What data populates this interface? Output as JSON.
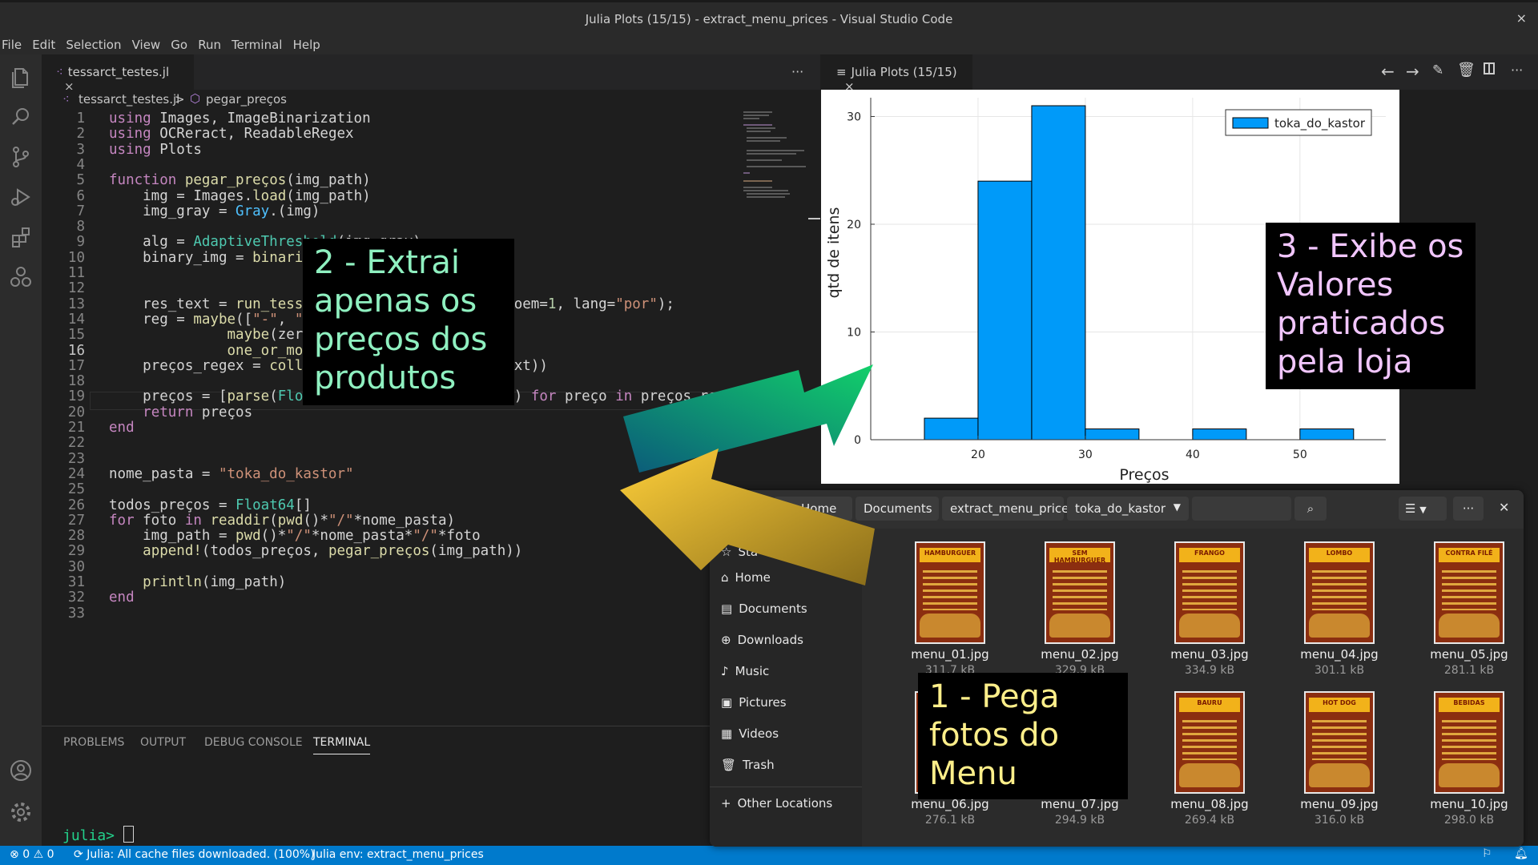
{
  "window": {
    "title": "Julia Plots (15/15) - extract_menu_prices - Visual Studio Code",
    "close": "×"
  },
  "menu": [
    "File",
    "Edit",
    "Selection",
    "View",
    "Go",
    "Run",
    "Terminal",
    "Help"
  ],
  "editor": {
    "tab_label": "tessarct_testes.jl",
    "tab_close": "×",
    "more": "···",
    "breadcrumb": {
      "file": "tessarct_testes.jl",
      "sep": ">",
      "symbol": "pegar_preços"
    },
    "current_line": 16
  },
  "panel": {
    "tabs": [
      "PROBLEMS",
      "OUTPUT",
      "DEBUG CONSOLE",
      "TERMINAL"
    ],
    "active": "TERMINAL",
    "prompt": "julia>"
  },
  "status": {
    "errors": "0",
    "warnings": "0",
    "julia_msg": "Julia: All cache files downloaded. (100%)",
    "env": "Julia env: extract_menu_prices"
  },
  "plot_pane": {
    "tab_label": "Julia Plots (15/15)",
    "tab_close": "×"
  },
  "chart_data": {
    "type": "bar",
    "xlabel": "Preços",
    "ylabel": "qtd de itens",
    "legend": "toka_do_kastor",
    "legend_position": "top-right",
    "color": "#009af9",
    "xlim": [
      10,
      58
    ],
    "ylim": [
      0,
      31
    ],
    "xticks": [
      20,
      30,
      40,
      50
    ],
    "yticks": [
      0,
      10,
      20,
      30
    ],
    "bins": [
      {
        "x0": 15,
        "x1": 20,
        "count": 2
      },
      {
        "x0": 20,
        "x1": 25,
        "count": 24
      },
      {
        "x0": 25,
        "x1": 30,
        "count": 31
      },
      {
        "x0": 30,
        "x1": 35,
        "count": 1
      },
      {
        "x0": 35,
        "x1": 40,
        "count": 0
      },
      {
        "x0": 40,
        "x1": 45,
        "count": 1
      },
      {
        "x0": 45,
        "x1": 50,
        "count": 0
      },
      {
        "x0": 50,
        "x1": 55,
        "count": 1
      }
    ],
    "grid": true
  },
  "file_manager": {
    "path": [
      "Home",
      "Documents",
      "extract_menu_prices",
      "toka_do_kastor"
    ],
    "sidebar": [
      "Sta",
      "Home",
      "Documents",
      "Downloads",
      "Music",
      "Pictures",
      "Videos",
      "Trash",
      "Other Locations"
    ],
    "files": [
      {
        "name": "menu_01.jpg",
        "size": "311.7 kB",
        "header": "HAMBURGUER"
      },
      {
        "name": "menu_02.jpg",
        "size": "329.9 kB",
        "header": "SEM HAMBURGUER"
      },
      {
        "name": "menu_03.jpg",
        "size": "334.9 kB",
        "header": "FRANGO"
      },
      {
        "name": "menu_04.jpg",
        "size": "301.1 kB",
        "header": "LOMBO"
      },
      {
        "name": "menu_05.jpg",
        "size": "281.1 kB",
        "header": "CONTRA FILÉ"
      },
      {
        "name": "menu_06.jpg",
        "size": "276.1 kB",
        "header": ""
      },
      {
        "name": "menu_07.jpg",
        "size": "294.9 kB",
        "header": ""
      },
      {
        "name": "menu_08.jpg",
        "size": "269.4 kB",
        "header": "BAURU"
      },
      {
        "name": "menu_09.jpg",
        "size": "316.0 kB",
        "header": "HOT DOG"
      },
      {
        "name": "menu_10.jpg",
        "size": "298.0 kB",
        "header": "BEBIDAS"
      }
    ]
  },
  "annotations": {
    "step2": [
      "2 - Extrai",
      "apenas os",
      "preços dos",
      "produtos"
    ],
    "step3": [
      "3 - Exibe os",
      "Valores",
      "praticados",
      "pela loja"
    ],
    "step1": [
      "1 - Pega",
      "fotos do",
      "Menu"
    ]
  },
  "colors": {
    "accent": "#007acc",
    "step2": "#8ff0c0",
    "step3": "#f2c6ff",
    "step1": "#ffef8a",
    "arrow_green": "#0fd079",
    "arrow_yellow": "#f6c52e"
  }
}
